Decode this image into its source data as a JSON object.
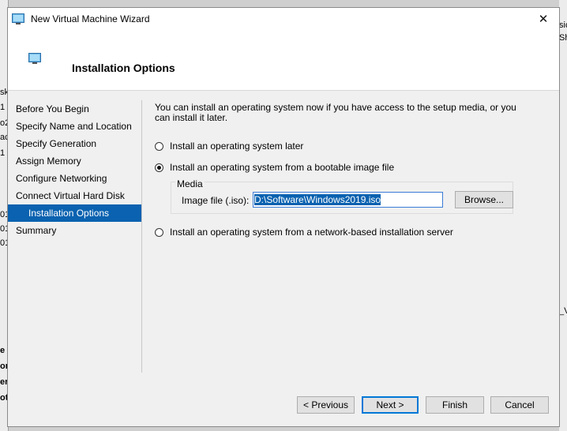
{
  "background": {
    "left_fragments": [
      "sk",
      "1",
      "o2",
      "ac",
      "1",
      "01",
      "01",
      "01",
      "e",
      "on",
      "er",
      "ot"
    ],
    "right_fragments": [
      "sic",
      "Sh",
      "_V"
    ]
  },
  "window": {
    "title": "New Virtual Machine Wizard",
    "close_glyph": "✕",
    "page_title": "Installation Options"
  },
  "nav": {
    "items": [
      {
        "label": "Before You Begin"
      },
      {
        "label": "Specify Name and Location"
      },
      {
        "label": "Specify Generation"
      },
      {
        "label": "Assign Memory"
      },
      {
        "label": "Configure Networking"
      },
      {
        "label": "Connect Virtual Hard Disk"
      },
      {
        "label": "Installation Options"
      },
      {
        "label": "Summary"
      }
    ],
    "active_index": 6
  },
  "content": {
    "intro": "You can install an operating system now if you have access to the setup media, or you can install it later.",
    "option_later": "Install an operating system later",
    "option_image": "Install an operating system from a bootable image file",
    "option_network": "Install an operating system from a network-based installation server",
    "selected_option": "image",
    "media_group_label": "Media",
    "image_file_label": "Image file (.iso):",
    "image_file_value": "D:\\Software\\Windows2019.iso",
    "browse_label": "Browse..."
  },
  "buttons": {
    "previous": "< Previous",
    "next": "Next >",
    "finish": "Finish",
    "cancel": "Cancel"
  },
  "colors": {
    "accent": "#0a62b0",
    "window_bg": "#f0f0f0"
  }
}
